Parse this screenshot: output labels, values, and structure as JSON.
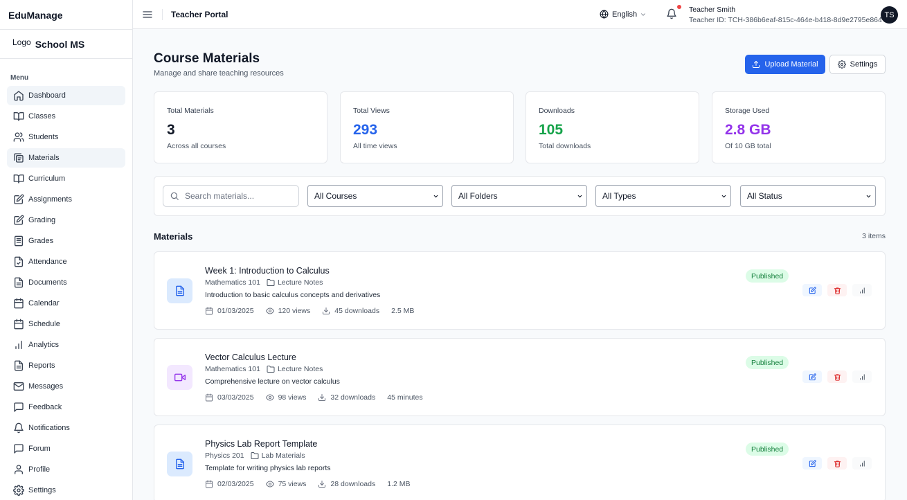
{
  "app": {
    "brand": "EduManage",
    "logo_text": "Logo",
    "school_name": "School MS"
  },
  "sidebar": {
    "menu_title": "Menu",
    "items": [
      {
        "label": "Dashboard",
        "icon": "home-icon"
      },
      {
        "label": "Classes",
        "icon": "book-open-icon"
      },
      {
        "label": "Students",
        "icon": "users-icon"
      },
      {
        "label": "Materials",
        "icon": "library-icon"
      },
      {
        "label": "Curriculum",
        "icon": "book-open-icon"
      },
      {
        "label": "Assignments",
        "icon": "edit-icon"
      },
      {
        "label": "Grading",
        "icon": "edit-icon"
      },
      {
        "label": "Grades",
        "icon": "file-text-icon"
      },
      {
        "label": "Attendance",
        "icon": "file-check-icon"
      },
      {
        "label": "Documents",
        "icon": "file-text-icon"
      },
      {
        "label": "Calendar",
        "icon": "calendar-icon"
      },
      {
        "label": "Schedule",
        "icon": "calendar-icon"
      },
      {
        "label": "Analytics",
        "icon": "bar-chart-icon"
      },
      {
        "label": "Reports",
        "icon": "file-text-icon"
      },
      {
        "label": "Messages",
        "icon": "mail-icon"
      },
      {
        "label": "Feedback",
        "icon": "message-square-icon"
      },
      {
        "label": "Notifications",
        "icon": "bell-icon"
      },
      {
        "label": "Forum",
        "icon": "message-square-icon"
      },
      {
        "label": "Profile",
        "icon": "user-icon"
      },
      {
        "label": "Settings",
        "icon": "gear-icon"
      }
    ]
  },
  "topbar": {
    "portal_title": "Teacher Portal",
    "language": "English",
    "user_name": "Teacher Smith",
    "user_id": "Teacher ID: TCH-386b6eaf-815c-464e-b418-8d9e2795e864",
    "avatar_initials": "TS"
  },
  "page": {
    "title": "Course Materials",
    "subtitle": "Manage and share teaching resources",
    "upload_label": "Upload Material",
    "settings_label": "Settings"
  },
  "stats": [
    {
      "label": "Total Materials",
      "value": "3",
      "sub": "Across all courses",
      "color": "#111827"
    },
    {
      "label": "Total Views",
      "value": "293",
      "sub": "All time views",
      "color": "#2563eb"
    },
    {
      "label": "Downloads",
      "value": "105",
      "sub": "Total downloads",
      "color": "#16a34a"
    },
    {
      "label": "Storage Used",
      "value": "2.8 GB",
      "sub": "Of 10 GB total",
      "color": "#9333ea"
    }
  ],
  "filters": {
    "search_placeholder": "Search materials...",
    "course": "All Courses",
    "folder": "All Folders",
    "type": "All Types",
    "status": "All Status"
  },
  "materials": {
    "title": "Materials",
    "count": "3 items",
    "items": [
      {
        "title": "Week 1: Introduction to Calculus",
        "course": "Mathematics 101",
        "folder": "Lecture Notes",
        "description": "Introduction to basic calculus concepts and derivatives",
        "date": "01/03/2025",
        "views": "120 views",
        "downloads": "45 downloads",
        "size": "2.5 MB",
        "status": "Published",
        "kind": "document"
      },
      {
        "title": "Vector Calculus Lecture",
        "course": "Mathematics 101",
        "folder": "Lecture Notes",
        "description": "Comprehensive lecture on vector calculus",
        "date": "03/03/2025",
        "views": "98 views",
        "downloads": "32 downloads",
        "size": "45 minutes",
        "status": "Published",
        "kind": "video"
      },
      {
        "title": "Physics Lab Report Template",
        "course": "Physics 201",
        "folder": "Lab Materials",
        "description": "Template for writing physics lab reports",
        "date": "02/03/2025",
        "views": "75 views",
        "downloads": "28 downloads",
        "size": "1.2 MB",
        "status": "Published",
        "kind": "document"
      }
    ]
  }
}
